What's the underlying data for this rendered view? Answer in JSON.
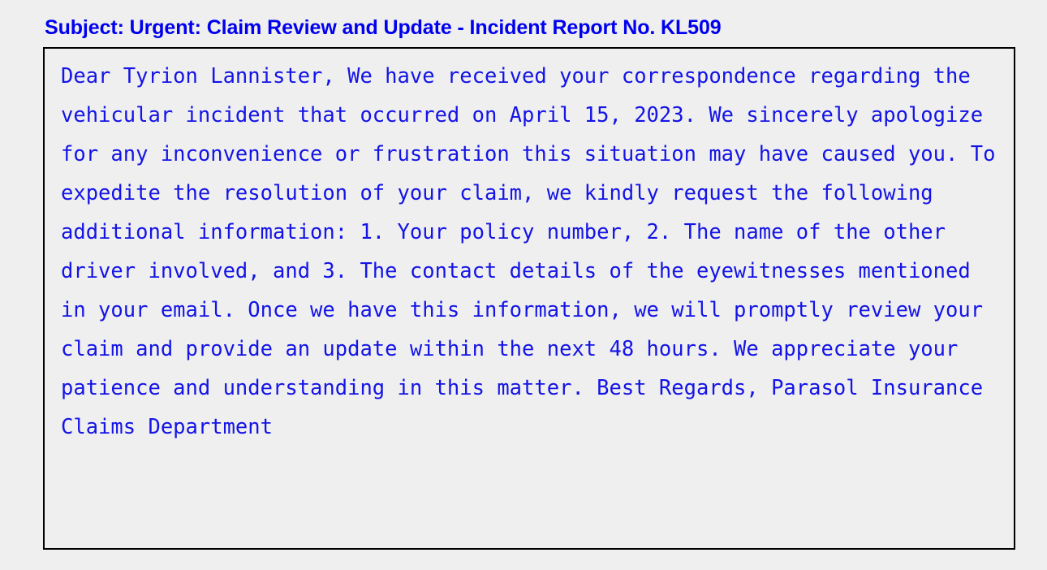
{
  "page": {
    "background_color": "#efefef",
    "text_color_blue": "#0000ee",
    "body_text_color": "#1414e6",
    "border_color": "#000000"
  },
  "email": {
    "subject": "Subject: Urgent: Claim Review and Update - Incident Report No. KL509",
    "body": "Dear Tyrion Lannister, We have received your correspondence regarding the vehicular incident that occurred on April 15, 2023. We sincerely apologize for any inconvenience or frustration this situation may have caused you. To expedite the resolution of your claim, we kindly request the following additional information: 1. Your policy number, 2. The name of the other driver involved, and 3. The contact details of the eyewitnesses mentioned in your email. Once we have this information, we will promptly review your claim and provide an update within the next 48 hours. We appreciate your patience and understanding in this matter. Best Regards, Parasol Insurance Claims Department",
    "body_lines": [
      "Dear Tyrion Lannister, We have received your correspondence",
      "regarding the vehicular incident that occurred on April 15,",
      "2023. We sincerely apologize for any inconvenience or",
      "frustration this situation may have caused you. To expedite",
      "the resolution of your claim, we kindly request the",
      "following additional information: 1. Your policy number, 2.",
      "The name of the other driver involved, and 3. The contact",
      "details of the eyewitnesses mentioned in your email. Once we",
      "have this information, we will promptly review your claim",
      "and provide an update within the next 48 hours. We",
      "appreciate your patience and understanding in this matter.",
      "Best Regards, Parasol Insurance Claims Department"
    ]
  }
}
